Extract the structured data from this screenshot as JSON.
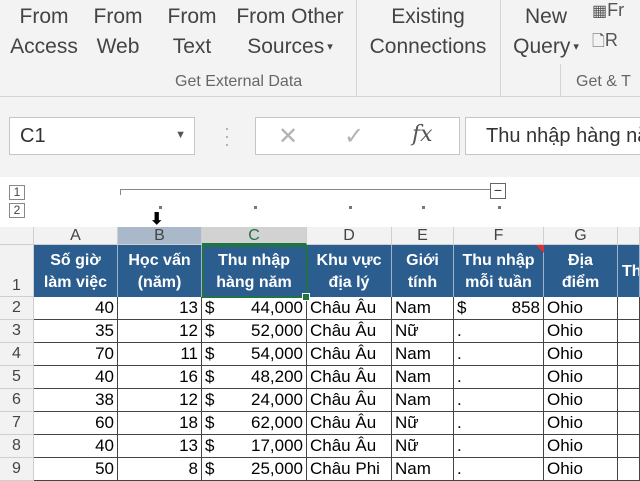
{
  "ribbon": {
    "buttons": [
      {
        "line1": "From",
        "line2": "Access"
      },
      {
        "line1": "From",
        "line2": "Web"
      },
      {
        "line1": "From",
        "line2": "Text"
      },
      {
        "line1": "From Other",
        "line2": "Sources"
      },
      {
        "line1": "Existing",
        "line2": "Connections"
      },
      {
        "line1": "New",
        "line2": "Query"
      }
    ],
    "group_label": "Get External Data",
    "group_label_2": "Get & T",
    "partial_btn_1": "Fr",
    "partial_btn_2": "R"
  },
  "formula_bar": {
    "name_box": "C1",
    "cancel_icon": "✕",
    "enter_icon": "✓",
    "fx_label": "fx",
    "formula": "Thu nhập hàng năm"
  },
  "outline": {
    "levels": [
      "1",
      "2"
    ],
    "collapse_symbol": "−"
  },
  "columns": [
    "A",
    "B",
    "C",
    "D",
    "E",
    "F",
    "G"
  ],
  "header_row": [
    "Số giờ\nlàm việc",
    "Học vấn\n(năm)",
    "Thu nhập\nhàng năm",
    "Khu vực\nđịa lý",
    "Giới\ntính",
    "Thu nhập\nmỗi tuần",
    "Địa\nđiểm",
    "Th"
  ],
  "rows": [
    {
      "num": "2",
      "a": "40",
      "b": "13",
      "c": "44,000",
      "d": "Châu Âu",
      "e": "Nam",
      "f_sym": "$",
      "f": "858",
      "g": "Ohio"
    },
    {
      "num": "3",
      "a": "35",
      "b": "12",
      "c": "52,000",
      "d": "Châu Âu",
      "e": "Nữ",
      "f_sym": ".",
      "f": "",
      "g": "Ohio"
    },
    {
      "num": "4",
      "a": "70",
      "b": "11",
      "c": "54,000",
      "d": "Châu Âu",
      "e": "Nam",
      "f_sym": ".",
      "f": "",
      "g": "Ohio"
    },
    {
      "num": "5",
      "a": "40",
      "b": "16",
      "c": "48,200",
      "d": "Châu Âu",
      "e": "Nam",
      "f_sym": ".",
      "f": "",
      "g": "Ohio"
    },
    {
      "num": "6",
      "a": "38",
      "b": "12",
      "c": "24,000",
      "d": "Châu Âu",
      "e": "Nam",
      "f_sym": ".",
      "f": "",
      "g": "Ohio"
    },
    {
      "num": "7",
      "a": "60",
      "b": "18",
      "c": "62,000",
      "d": "Châu Âu",
      "e": "Nữ",
      "f_sym": ".",
      "f": "",
      "g": "Ohio"
    },
    {
      "num": "8",
      "a": "40",
      "b": "13",
      "c": "17,000",
      "d": "Châu Âu",
      "e": "Nữ",
      "f_sym": ".",
      "f": "",
      "g": "Ohio"
    },
    {
      "num": "9",
      "a": "50",
      "b": "8",
      "c": "25,000",
      "d": "Châu Phi",
      "e": "Nam",
      "f_sym": ".",
      "f": "",
      "g": "Ohio"
    }
  ],
  "currency_symbol": "$",
  "header_row_num": "1",
  "colors": {
    "header_fill": "#2b5d8f",
    "selection": "#217346",
    "ribbon_bg": "#f3f3f3"
  }
}
